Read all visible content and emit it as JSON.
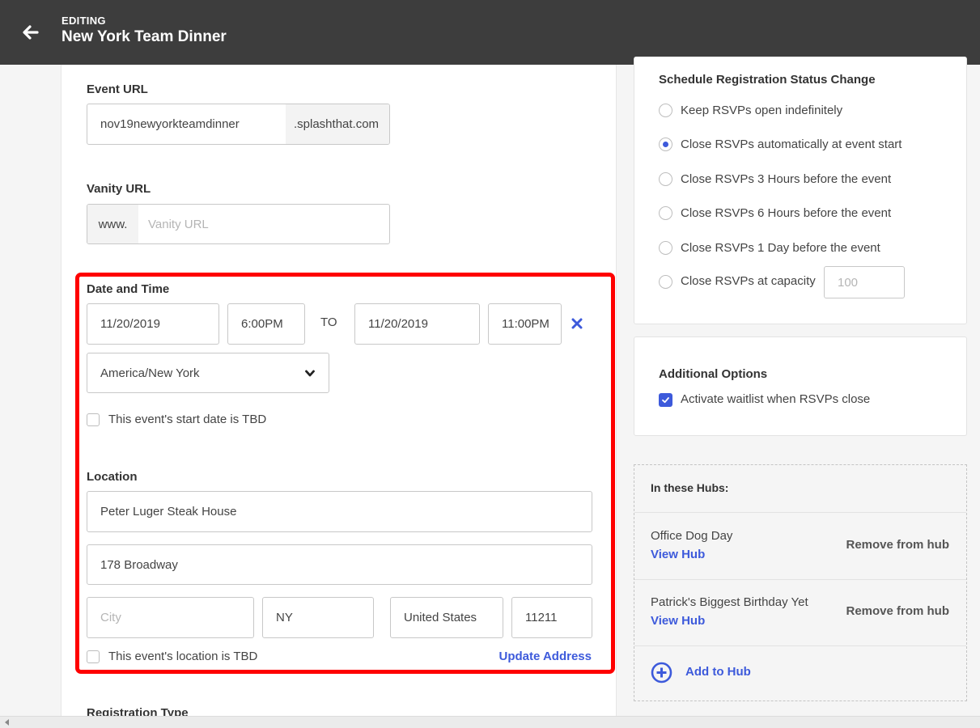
{
  "header": {
    "subtitle": "EDITING",
    "title": "New York Team Dinner"
  },
  "event_url": {
    "label": "Event URL",
    "value": "nov19newyorkteamdinner",
    "suffix": ".splashthat.com"
  },
  "vanity_url": {
    "label": "Vanity URL",
    "prefix": "www.",
    "placeholder": "Vanity URL"
  },
  "date_time": {
    "label": "Date and Time",
    "start_date": "11/20/2019",
    "start_time": "6:00PM",
    "to_label": "TO",
    "end_date": "11/20/2019",
    "end_time": "11:00PM",
    "timezone": "America/New York",
    "tbd_label": "This event's start date is TBD"
  },
  "location": {
    "label": "Location",
    "venue": "Peter Luger Steak House",
    "address": "178 Broadway",
    "city_placeholder": "City",
    "state": "NY",
    "country": "United States",
    "zip": "11211",
    "tbd_label": "This event's location is TBD",
    "update_label": "Update Address"
  },
  "registration_type_label": "Registration Type",
  "schedule": {
    "title": "Schedule Registration Status Change",
    "options": [
      "Keep RSVPs open indefinitely",
      "Close RSVPs automatically at event start",
      "Close RSVPs 3 Hours before the event",
      "Close RSVPs 6 Hours before the event",
      "Close RSVPs 1 Day before the event",
      "Close RSVPs at capacity"
    ],
    "selected_index": 1,
    "capacity_placeholder": "100"
  },
  "additional": {
    "title": "Additional Options",
    "waitlist_label": "Activate waitlist when RSVPs close",
    "waitlist_checked": true
  },
  "hubs": {
    "title": "In these Hubs:",
    "items": [
      {
        "name": "Office Dog Day",
        "view": "View Hub",
        "remove": "Remove from hub"
      },
      {
        "name": "Patrick's Biggest Birthday Yet",
        "view": "View Hub",
        "remove": "Remove from hub"
      }
    ],
    "add_label": "Add to Hub"
  },
  "colors": {
    "accent": "#3d5adb",
    "highlight": "#ff0000",
    "topbar": "#3d3d3d"
  }
}
